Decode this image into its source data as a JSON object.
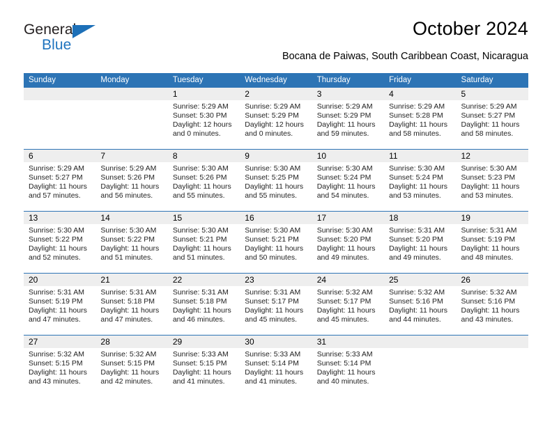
{
  "brand": {
    "name_part1": "General",
    "name_part2": "Blue",
    "accent_color": "#1d70b8",
    "triangle_icon": "triangle-logo-icon"
  },
  "header": {
    "title": "October 2024",
    "subtitle": "Bocana de Paiwas, South Caribbean Coast, Nicaragua"
  },
  "calendar": {
    "header_bg": "#2d74b5",
    "daynum_bg": "#eeeeee",
    "weekday_names": [
      "Sunday",
      "Monday",
      "Tuesday",
      "Wednesday",
      "Thursday",
      "Friday",
      "Saturday"
    ],
    "weeks": [
      [
        {
          "day": "",
          "sunrise": "",
          "sunset": "",
          "daylight1": "",
          "daylight2": ""
        },
        {
          "day": "",
          "sunrise": "",
          "sunset": "",
          "daylight1": "",
          "daylight2": ""
        },
        {
          "day": "1",
          "sunrise": "Sunrise: 5:29 AM",
          "sunset": "Sunset: 5:30 PM",
          "daylight1": "Daylight: 12 hours",
          "daylight2": "and 0 minutes."
        },
        {
          "day": "2",
          "sunrise": "Sunrise: 5:29 AM",
          "sunset": "Sunset: 5:29 PM",
          "daylight1": "Daylight: 12 hours",
          "daylight2": "and 0 minutes."
        },
        {
          "day": "3",
          "sunrise": "Sunrise: 5:29 AM",
          "sunset": "Sunset: 5:29 PM",
          "daylight1": "Daylight: 11 hours",
          "daylight2": "and 59 minutes."
        },
        {
          "day": "4",
          "sunrise": "Sunrise: 5:29 AM",
          "sunset": "Sunset: 5:28 PM",
          "daylight1": "Daylight: 11 hours",
          "daylight2": "and 58 minutes."
        },
        {
          "day": "5",
          "sunrise": "Sunrise: 5:29 AM",
          "sunset": "Sunset: 5:27 PM",
          "daylight1": "Daylight: 11 hours",
          "daylight2": "and 58 minutes."
        }
      ],
      [
        {
          "day": "6",
          "sunrise": "Sunrise: 5:29 AM",
          "sunset": "Sunset: 5:27 PM",
          "daylight1": "Daylight: 11 hours",
          "daylight2": "and 57 minutes."
        },
        {
          "day": "7",
          "sunrise": "Sunrise: 5:29 AM",
          "sunset": "Sunset: 5:26 PM",
          "daylight1": "Daylight: 11 hours",
          "daylight2": "and 56 minutes."
        },
        {
          "day": "8",
          "sunrise": "Sunrise: 5:30 AM",
          "sunset": "Sunset: 5:26 PM",
          "daylight1": "Daylight: 11 hours",
          "daylight2": "and 55 minutes."
        },
        {
          "day": "9",
          "sunrise": "Sunrise: 5:30 AM",
          "sunset": "Sunset: 5:25 PM",
          "daylight1": "Daylight: 11 hours",
          "daylight2": "and 55 minutes."
        },
        {
          "day": "10",
          "sunrise": "Sunrise: 5:30 AM",
          "sunset": "Sunset: 5:24 PM",
          "daylight1": "Daylight: 11 hours",
          "daylight2": "and 54 minutes."
        },
        {
          "day": "11",
          "sunrise": "Sunrise: 5:30 AM",
          "sunset": "Sunset: 5:24 PM",
          "daylight1": "Daylight: 11 hours",
          "daylight2": "and 53 minutes."
        },
        {
          "day": "12",
          "sunrise": "Sunrise: 5:30 AM",
          "sunset": "Sunset: 5:23 PM",
          "daylight1": "Daylight: 11 hours",
          "daylight2": "and 53 minutes."
        }
      ],
      [
        {
          "day": "13",
          "sunrise": "Sunrise: 5:30 AM",
          "sunset": "Sunset: 5:22 PM",
          "daylight1": "Daylight: 11 hours",
          "daylight2": "and 52 minutes."
        },
        {
          "day": "14",
          "sunrise": "Sunrise: 5:30 AM",
          "sunset": "Sunset: 5:22 PM",
          "daylight1": "Daylight: 11 hours",
          "daylight2": "and 51 minutes."
        },
        {
          "day": "15",
          "sunrise": "Sunrise: 5:30 AM",
          "sunset": "Sunset: 5:21 PM",
          "daylight1": "Daylight: 11 hours",
          "daylight2": "and 51 minutes."
        },
        {
          "day": "16",
          "sunrise": "Sunrise: 5:30 AM",
          "sunset": "Sunset: 5:21 PM",
          "daylight1": "Daylight: 11 hours",
          "daylight2": "and 50 minutes."
        },
        {
          "day": "17",
          "sunrise": "Sunrise: 5:30 AM",
          "sunset": "Sunset: 5:20 PM",
          "daylight1": "Daylight: 11 hours",
          "daylight2": "and 49 minutes."
        },
        {
          "day": "18",
          "sunrise": "Sunrise: 5:31 AM",
          "sunset": "Sunset: 5:20 PM",
          "daylight1": "Daylight: 11 hours",
          "daylight2": "and 49 minutes."
        },
        {
          "day": "19",
          "sunrise": "Sunrise: 5:31 AM",
          "sunset": "Sunset: 5:19 PM",
          "daylight1": "Daylight: 11 hours",
          "daylight2": "and 48 minutes."
        }
      ],
      [
        {
          "day": "20",
          "sunrise": "Sunrise: 5:31 AM",
          "sunset": "Sunset: 5:19 PM",
          "daylight1": "Daylight: 11 hours",
          "daylight2": "and 47 minutes."
        },
        {
          "day": "21",
          "sunrise": "Sunrise: 5:31 AM",
          "sunset": "Sunset: 5:18 PM",
          "daylight1": "Daylight: 11 hours",
          "daylight2": "and 47 minutes."
        },
        {
          "day": "22",
          "sunrise": "Sunrise: 5:31 AM",
          "sunset": "Sunset: 5:18 PM",
          "daylight1": "Daylight: 11 hours",
          "daylight2": "and 46 minutes."
        },
        {
          "day": "23",
          "sunrise": "Sunrise: 5:31 AM",
          "sunset": "Sunset: 5:17 PM",
          "daylight1": "Daylight: 11 hours",
          "daylight2": "and 45 minutes."
        },
        {
          "day": "24",
          "sunrise": "Sunrise: 5:32 AM",
          "sunset": "Sunset: 5:17 PM",
          "daylight1": "Daylight: 11 hours",
          "daylight2": "and 45 minutes."
        },
        {
          "day": "25",
          "sunrise": "Sunrise: 5:32 AM",
          "sunset": "Sunset: 5:16 PM",
          "daylight1": "Daylight: 11 hours",
          "daylight2": "and 44 minutes."
        },
        {
          "day": "26",
          "sunrise": "Sunrise: 5:32 AM",
          "sunset": "Sunset: 5:16 PM",
          "daylight1": "Daylight: 11 hours",
          "daylight2": "and 43 minutes."
        }
      ],
      [
        {
          "day": "27",
          "sunrise": "Sunrise: 5:32 AM",
          "sunset": "Sunset: 5:15 PM",
          "daylight1": "Daylight: 11 hours",
          "daylight2": "and 43 minutes."
        },
        {
          "day": "28",
          "sunrise": "Sunrise: 5:32 AM",
          "sunset": "Sunset: 5:15 PM",
          "daylight1": "Daylight: 11 hours",
          "daylight2": "and 42 minutes."
        },
        {
          "day": "29",
          "sunrise": "Sunrise: 5:33 AM",
          "sunset": "Sunset: 5:15 PM",
          "daylight1": "Daylight: 11 hours",
          "daylight2": "and 41 minutes."
        },
        {
          "day": "30",
          "sunrise": "Sunrise: 5:33 AM",
          "sunset": "Sunset: 5:14 PM",
          "daylight1": "Daylight: 11 hours",
          "daylight2": "and 41 minutes."
        },
        {
          "day": "31",
          "sunrise": "Sunrise: 5:33 AM",
          "sunset": "Sunset: 5:14 PM",
          "daylight1": "Daylight: 11 hours",
          "daylight2": "and 40 minutes."
        },
        {
          "day": "",
          "sunrise": "",
          "sunset": "",
          "daylight1": "",
          "daylight2": ""
        },
        {
          "day": "",
          "sunrise": "",
          "sunset": "",
          "daylight1": "",
          "daylight2": ""
        }
      ]
    ]
  }
}
